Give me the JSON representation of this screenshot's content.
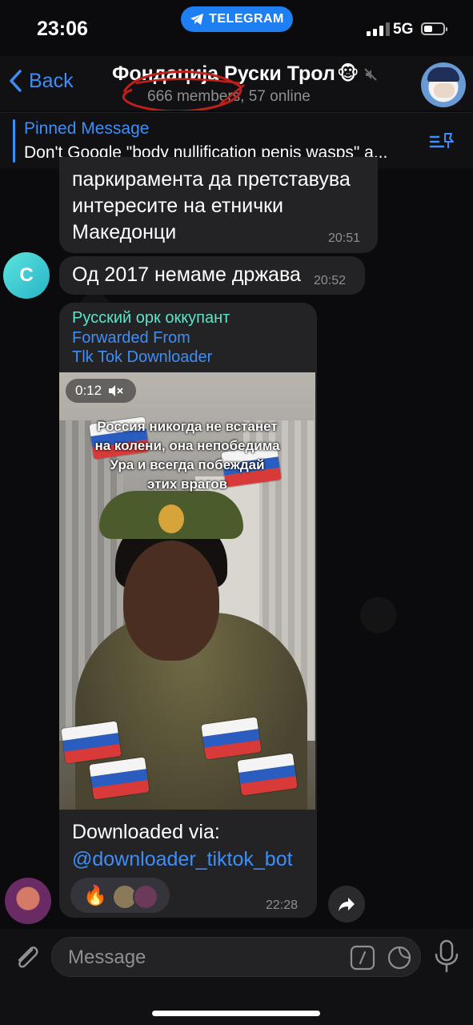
{
  "status": {
    "time": "23:06",
    "app_pill": "TELEGRAM",
    "network": "5G"
  },
  "header": {
    "back_label": "Back",
    "title": "Фондација Руски Трол",
    "title_emoji": "🐵",
    "subtitle": "666 members, 57 online"
  },
  "pinned": {
    "title": "Pinned Message",
    "text": "Don't Google \"body nullification penis wasps\" a..."
  },
  "messages": [
    {
      "lines": [
        "паркирамента да претставува",
        "интересите на етнички",
        "Македонци"
      ],
      "time": "20:51"
    },
    {
      "avatar_letter": "C",
      "text": "Од 2017 немаме држава",
      "time": "20:52"
    },
    {
      "sender": "Русский орк оккупант",
      "forwarded_label": "Forwarded From",
      "forwarded_from": "Tlk Tok Downloader",
      "video_duration": "0:12",
      "video_caption": [
        "Россия никогда не встанет",
        "на колени, она непобедима",
        "Ура и всегда побеждай",
        "этих врагов"
      ],
      "body": "Downloaded via:",
      "link": "@downloader_tiktok_bot",
      "reaction_emoji": "🔥",
      "time": "22:28"
    }
  ],
  "composer": {
    "placeholder": "Message"
  },
  "colors": {
    "accent": "#3e8ef7",
    "bubble": "#232326",
    "sender": "#5ee4c8",
    "telegram_pill": "#1e7ff2"
  }
}
